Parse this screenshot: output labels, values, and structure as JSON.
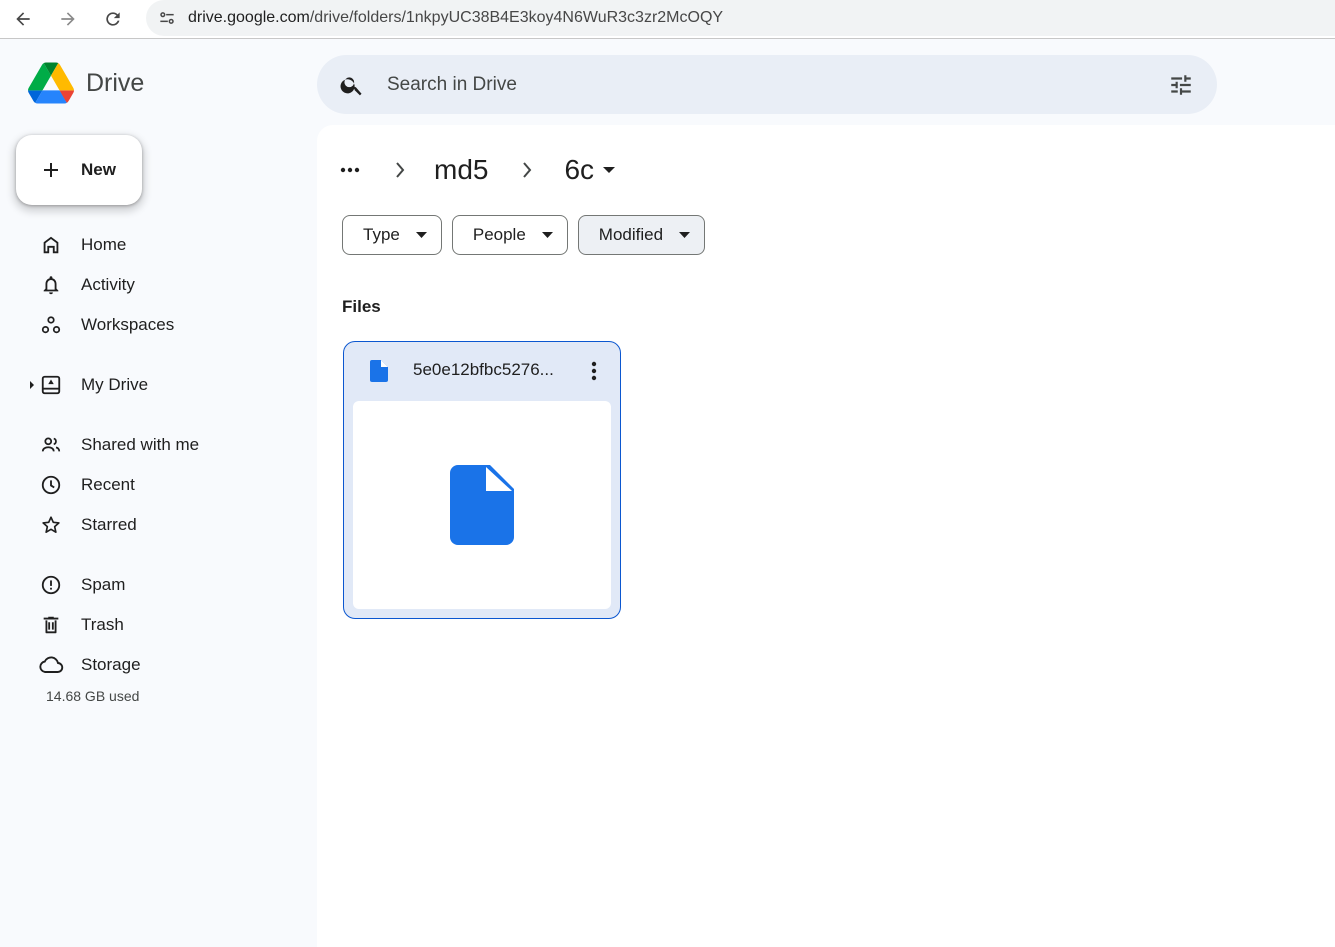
{
  "browser": {
    "url_host": "drive.google.com",
    "url_path": "/drive/folders/1nkpyUC38B4E3koy4N6WuR3c3zr2McOQY"
  },
  "app": {
    "name": "Drive",
    "search_placeholder": "Search in Drive",
    "new_label": "New"
  },
  "sidebar": {
    "items": [
      {
        "label": "Home",
        "icon": "home-icon"
      },
      {
        "label": "Activity",
        "icon": "bell-icon"
      },
      {
        "label": "Workspaces",
        "icon": "workspaces-icon"
      },
      {
        "label": "My Drive",
        "icon": "my-drive-icon"
      },
      {
        "label": "Shared with me",
        "icon": "people-icon"
      },
      {
        "label": "Recent",
        "icon": "clock-icon"
      },
      {
        "label": "Starred",
        "icon": "star-icon"
      },
      {
        "label": "Spam",
        "icon": "spam-icon"
      },
      {
        "label": "Trash",
        "icon": "trash-icon"
      },
      {
        "label": "Storage",
        "icon": "cloud-icon"
      }
    ],
    "storage_used": "14.68 GB used"
  },
  "breadcrumb": {
    "parent": "md5",
    "current": "6c"
  },
  "filters": {
    "type": "Type",
    "people": "People",
    "modified": "Modified"
  },
  "section": {
    "files_label": "Files"
  },
  "files": [
    {
      "name": "5e0e12bfbc5276..."
    }
  ],
  "colors": {
    "accent": "#0b57d0",
    "doc_blue": "#1a73e8",
    "search_bg": "#e9eef6",
    "page_bg": "#f8fafd"
  }
}
